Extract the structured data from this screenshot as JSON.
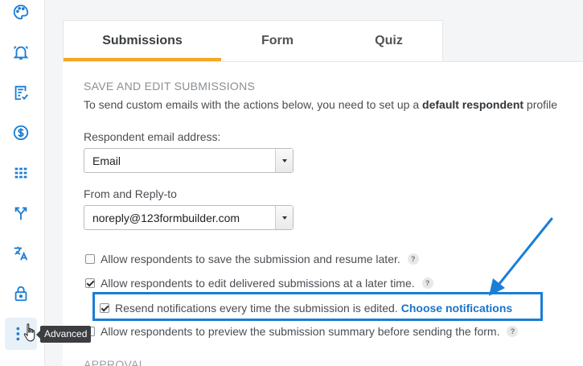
{
  "sidebar": {
    "items": [
      {
        "icon": "palette-icon"
      },
      {
        "icon": "bell-alarm-icon"
      },
      {
        "icon": "checklist-icon"
      },
      {
        "icon": "dollar-icon"
      },
      {
        "icon": "grid-apps-icon"
      },
      {
        "icon": "merge-arrows-icon"
      },
      {
        "icon": "translate-icon"
      },
      {
        "icon": "lock-icon"
      },
      {
        "icon": "more-vertical-icon"
      }
    ],
    "tooltip": "Advanced",
    "accent": "#1a7ed6"
  },
  "tabs": {
    "items": [
      "Submissions",
      "Form",
      "Quiz"
    ],
    "active_index": 0,
    "accent": "#f5a623"
  },
  "section": {
    "title": "SAVE AND EDIT SUBMISSIONS",
    "desc_prefix": "To send custom emails with the actions below, you need to set up a ",
    "desc_bold": "default respondent",
    "desc_suffix": " profile"
  },
  "respondent_email": {
    "label": "Respondent email address:",
    "value": "Email"
  },
  "from_reply": {
    "label": "From and Reply-to",
    "value": "noreply@123formbuilder.com"
  },
  "options": {
    "allow_save": {
      "label": "Allow respondents to save the submission and resume later.",
      "checked": false
    },
    "allow_edit": {
      "label": "Allow respondents to edit delivered submissions at a later time.",
      "checked": true
    },
    "resend": {
      "label": "Resend notifications every time the submission is edited.",
      "link": "Choose notifications",
      "checked": true
    },
    "allow_preview": {
      "label": "Allow respondents to preview the submission summary before sending the form.",
      "checked": false
    },
    "help_glyph": "?"
  },
  "next_section_partial": "APPROVAL"
}
